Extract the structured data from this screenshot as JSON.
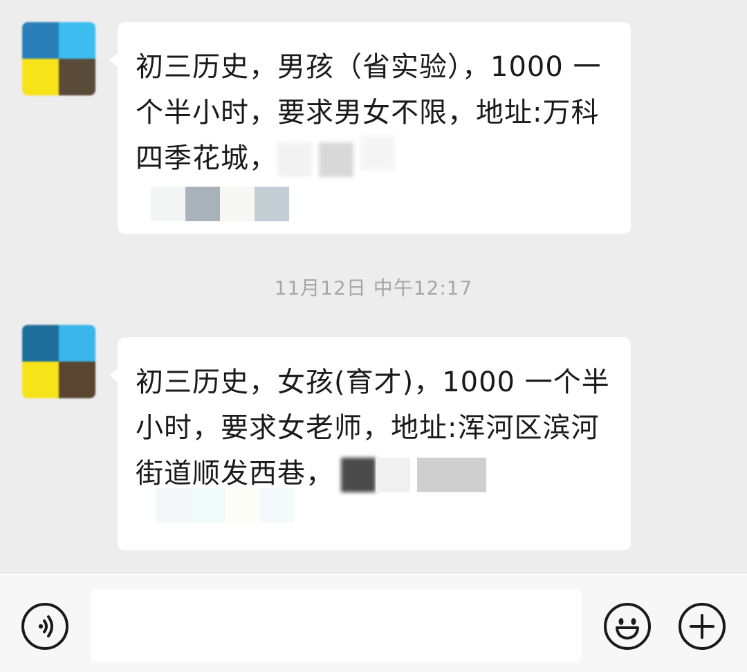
{
  "messages": [
    {
      "sender": "other",
      "avatar_colors": [
        "#2a7fb8",
        "#3dbdf0",
        "#f7e31a",
        "#5a4a3a"
      ],
      "text": "初三历史，男孩（省实验），1000 一个半小时，要求男女不限，地址:万科四季花城，"
    },
    {
      "sender": "other",
      "avatar_colors": [
        "#1e6e9c",
        "#3ab6ea",
        "#f7e31a",
        "#5a4530"
      ],
      "text": "初三历史，女孩(育才)，1000 一个半小时，要求女老师，地址:浑河区滨河街道顺发西巷，"
    }
  ],
  "timestamp": "11月12日 中午12:17",
  "input_bar": {
    "placeholder": "",
    "voice_icon": "voice-icon",
    "emoji_icon": "emoji-smile-icon",
    "plus_icon": "plus-icon"
  }
}
